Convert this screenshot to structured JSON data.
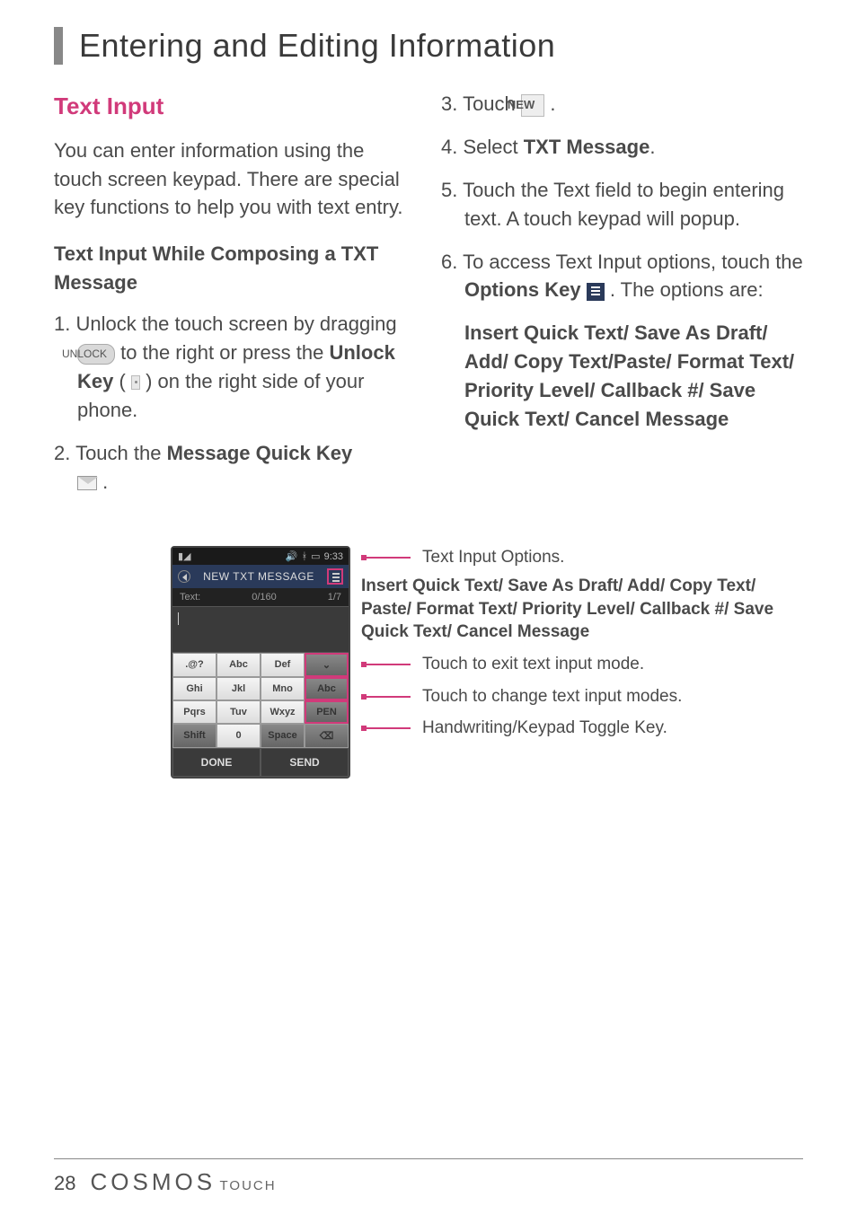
{
  "page_title": "Entering and Editing Information",
  "sections": {
    "text_input_heading": "Text Input",
    "intro": "You can enter information using the touch screen keypad. There are special key functions to help you with text entry.",
    "sub1": "Text Input While Composing a TXT Message",
    "steps_left": {
      "s1_a": "1. Unlock the touch screen by dragging ",
      "s1_badge": "UNLOCK",
      "s1_b": " to the right or press the ",
      "s1_bold": "Unlock Key",
      "s1_c": " ( ",
      "s1_d": " ) on the right side of your phone.",
      "s2_a": "2. Touch the ",
      "s2_bold": "Message Quick Key",
      "s2_b": "."
    },
    "steps_right": {
      "s3_a": "3. Touch ",
      "s3_btn": "NEW",
      "s3_b": " .",
      "s4_a": "4. Select ",
      "s4_bold": "TXT Message",
      "s4_b": ".",
      "s5": "5. Touch the Text field to begin entering text. A touch keypad will popup.",
      "s6_a": "6. To access Text Input options, touch the ",
      "s6_bold": "Options Key",
      "s6_b": " . The options are:",
      "s6_opts": "Insert Quick Text/ Save As Draft/ Add/ Copy Text/Paste/ Format Text/ Priority Level/ Callback #/ Save Quick Text/ Cancel Message"
    }
  },
  "phone": {
    "status_time": "9:33",
    "title": "NEW TXT MESSAGE",
    "text_label": "Text:",
    "count": "0/160",
    "page_idx": "1/7",
    "keys": [
      ".@?",
      "Abc",
      "Def",
      "⌄",
      "Ghi",
      "Jkl",
      "Mno",
      "Abc",
      "Pqrs",
      "Tuv",
      "Wxyz",
      "PEN",
      "Shift",
      "0",
      "Space",
      "⌫"
    ],
    "done": "DONE",
    "send": "SEND"
  },
  "callouts": {
    "c1": "Text Input Options.",
    "c1b": "Insert Quick Text/ Save As Draft/ Add/ Copy Text/ Paste/ Format Text/ Priority Level/ Callback #/ Save Quick Text/ Cancel Message",
    "c2": "Touch to exit text input mode.",
    "c3": "Touch to change text input modes.",
    "c4": "Handwriting/Keypad Toggle Key."
  },
  "footer": {
    "page": "28",
    "brand": "COSMOS",
    "brand_sub": "TOUCH"
  }
}
